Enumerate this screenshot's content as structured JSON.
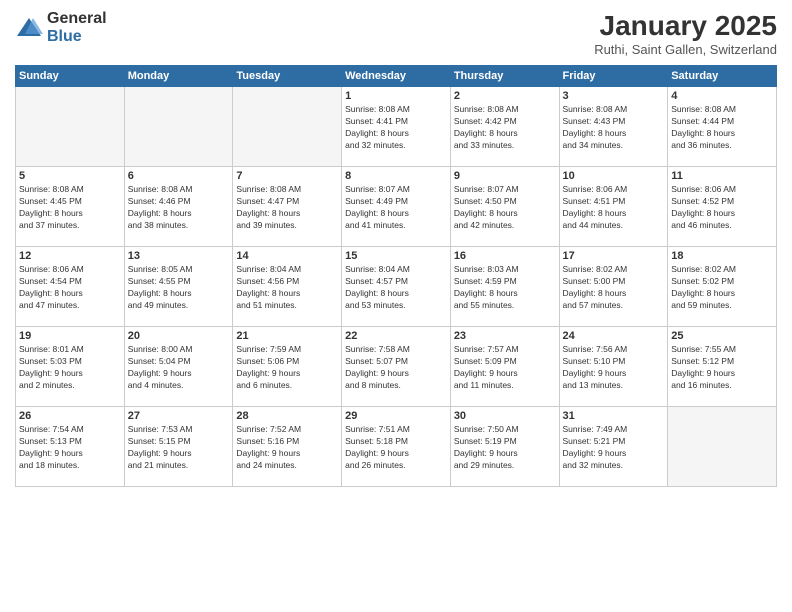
{
  "logo": {
    "general": "General",
    "blue": "Blue"
  },
  "title": "January 2025",
  "subtitle": "Ruthi, Saint Gallen, Switzerland",
  "days_of_week": [
    "Sunday",
    "Monday",
    "Tuesday",
    "Wednesday",
    "Thursday",
    "Friday",
    "Saturday"
  ],
  "weeks": [
    [
      {
        "day": "",
        "info": "",
        "empty": true
      },
      {
        "day": "",
        "info": "",
        "empty": true
      },
      {
        "day": "",
        "info": "",
        "empty": true
      },
      {
        "day": "1",
        "info": "Sunrise: 8:08 AM\nSunset: 4:41 PM\nDaylight: 8 hours\nand 32 minutes.",
        "empty": false
      },
      {
        "day": "2",
        "info": "Sunrise: 8:08 AM\nSunset: 4:42 PM\nDaylight: 8 hours\nand 33 minutes.",
        "empty": false
      },
      {
        "day": "3",
        "info": "Sunrise: 8:08 AM\nSunset: 4:43 PM\nDaylight: 8 hours\nand 34 minutes.",
        "empty": false
      },
      {
        "day": "4",
        "info": "Sunrise: 8:08 AM\nSunset: 4:44 PM\nDaylight: 8 hours\nand 36 minutes.",
        "empty": false
      }
    ],
    [
      {
        "day": "5",
        "info": "Sunrise: 8:08 AM\nSunset: 4:45 PM\nDaylight: 8 hours\nand 37 minutes.",
        "empty": false
      },
      {
        "day": "6",
        "info": "Sunrise: 8:08 AM\nSunset: 4:46 PM\nDaylight: 8 hours\nand 38 minutes.",
        "empty": false
      },
      {
        "day": "7",
        "info": "Sunrise: 8:08 AM\nSunset: 4:47 PM\nDaylight: 8 hours\nand 39 minutes.",
        "empty": false
      },
      {
        "day": "8",
        "info": "Sunrise: 8:07 AM\nSunset: 4:49 PM\nDaylight: 8 hours\nand 41 minutes.",
        "empty": false
      },
      {
        "day": "9",
        "info": "Sunrise: 8:07 AM\nSunset: 4:50 PM\nDaylight: 8 hours\nand 42 minutes.",
        "empty": false
      },
      {
        "day": "10",
        "info": "Sunrise: 8:06 AM\nSunset: 4:51 PM\nDaylight: 8 hours\nand 44 minutes.",
        "empty": false
      },
      {
        "day": "11",
        "info": "Sunrise: 8:06 AM\nSunset: 4:52 PM\nDaylight: 8 hours\nand 46 minutes.",
        "empty": false
      }
    ],
    [
      {
        "day": "12",
        "info": "Sunrise: 8:06 AM\nSunset: 4:54 PM\nDaylight: 8 hours\nand 47 minutes.",
        "empty": false
      },
      {
        "day": "13",
        "info": "Sunrise: 8:05 AM\nSunset: 4:55 PM\nDaylight: 8 hours\nand 49 minutes.",
        "empty": false
      },
      {
        "day": "14",
        "info": "Sunrise: 8:04 AM\nSunset: 4:56 PM\nDaylight: 8 hours\nand 51 minutes.",
        "empty": false
      },
      {
        "day": "15",
        "info": "Sunrise: 8:04 AM\nSunset: 4:57 PM\nDaylight: 8 hours\nand 53 minutes.",
        "empty": false
      },
      {
        "day": "16",
        "info": "Sunrise: 8:03 AM\nSunset: 4:59 PM\nDaylight: 8 hours\nand 55 minutes.",
        "empty": false
      },
      {
        "day": "17",
        "info": "Sunrise: 8:02 AM\nSunset: 5:00 PM\nDaylight: 8 hours\nand 57 minutes.",
        "empty": false
      },
      {
        "day": "18",
        "info": "Sunrise: 8:02 AM\nSunset: 5:02 PM\nDaylight: 8 hours\nand 59 minutes.",
        "empty": false
      }
    ],
    [
      {
        "day": "19",
        "info": "Sunrise: 8:01 AM\nSunset: 5:03 PM\nDaylight: 9 hours\nand 2 minutes.",
        "empty": false
      },
      {
        "day": "20",
        "info": "Sunrise: 8:00 AM\nSunset: 5:04 PM\nDaylight: 9 hours\nand 4 minutes.",
        "empty": false
      },
      {
        "day": "21",
        "info": "Sunrise: 7:59 AM\nSunset: 5:06 PM\nDaylight: 9 hours\nand 6 minutes.",
        "empty": false
      },
      {
        "day": "22",
        "info": "Sunrise: 7:58 AM\nSunset: 5:07 PM\nDaylight: 9 hours\nand 8 minutes.",
        "empty": false
      },
      {
        "day": "23",
        "info": "Sunrise: 7:57 AM\nSunset: 5:09 PM\nDaylight: 9 hours\nand 11 minutes.",
        "empty": false
      },
      {
        "day": "24",
        "info": "Sunrise: 7:56 AM\nSunset: 5:10 PM\nDaylight: 9 hours\nand 13 minutes.",
        "empty": false
      },
      {
        "day": "25",
        "info": "Sunrise: 7:55 AM\nSunset: 5:12 PM\nDaylight: 9 hours\nand 16 minutes.",
        "empty": false
      }
    ],
    [
      {
        "day": "26",
        "info": "Sunrise: 7:54 AM\nSunset: 5:13 PM\nDaylight: 9 hours\nand 18 minutes.",
        "empty": false
      },
      {
        "day": "27",
        "info": "Sunrise: 7:53 AM\nSunset: 5:15 PM\nDaylight: 9 hours\nand 21 minutes.",
        "empty": false
      },
      {
        "day": "28",
        "info": "Sunrise: 7:52 AM\nSunset: 5:16 PM\nDaylight: 9 hours\nand 24 minutes.",
        "empty": false
      },
      {
        "day": "29",
        "info": "Sunrise: 7:51 AM\nSunset: 5:18 PM\nDaylight: 9 hours\nand 26 minutes.",
        "empty": false
      },
      {
        "day": "30",
        "info": "Sunrise: 7:50 AM\nSunset: 5:19 PM\nDaylight: 9 hours\nand 29 minutes.",
        "empty": false
      },
      {
        "day": "31",
        "info": "Sunrise: 7:49 AM\nSunset: 5:21 PM\nDaylight: 9 hours\nand 32 minutes.",
        "empty": false
      },
      {
        "day": "",
        "info": "",
        "empty": true
      }
    ]
  ]
}
